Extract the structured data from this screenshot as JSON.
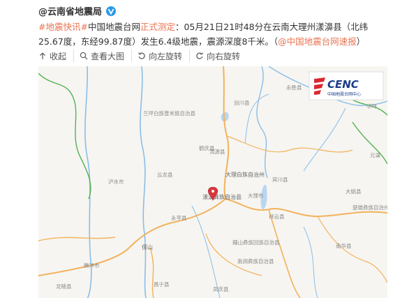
{
  "post": {
    "author": "@云南省地震局",
    "text": {
      "tag": "#地震快讯#",
      "prefix": "中国地震台网",
      "highlight": "正式测定",
      "body": "：05月21日21时48分在云南大理州漾濞县（北纬25.67度，东经99.87度）发生6.4级地震，震源深度8千米。（",
      "link": "@中国地震台网速报",
      "suffix": "）"
    },
    "toolbar": {
      "collapse": "收起",
      "view_large": "查看大图",
      "rotate_left": "向左旋转",
      "rotate_right": "向右旋转"
    },
    "map": {
      "logo_text": "CENC",
      "logo_subtext": "中国地震台网中心",
      "labels": {
        "yongsheng": "永胜县",
        "jianchuan": "剑川县",
        "heqing": "鹤庆县",
        "lanping": "兰坪白族普米族自治县",
        "eryuan": "洱源县",
        "binchuan": "宾川县",
        "dali": "大理白族自治州",
        "yunlong": "云龙县",
        "lushui": "泸水市",
        "yangbi": "漾濞彝族自治县",
        "dali_city": "大理市",
        "xiangyun": "祥云县",
        "dayao": "大姚县",
        "yongping": "永平县",
        "chuxiong": "楚雄彝族自治州",
        "baoshan": "保山",
        "weishan": "巍山彝族回族自治县",
        "nanjian": "南涧彝族自治县",
        "nanhua": "南华县",
        "tengchong": "腾冲市",
        "longling": "龙陵县",
        "changning": "昌宁县",
        "fengqing": "凤庆县",
        "yuanmou": "元谋",
        "huaping": "华坪"
      }
    }
  }
}
